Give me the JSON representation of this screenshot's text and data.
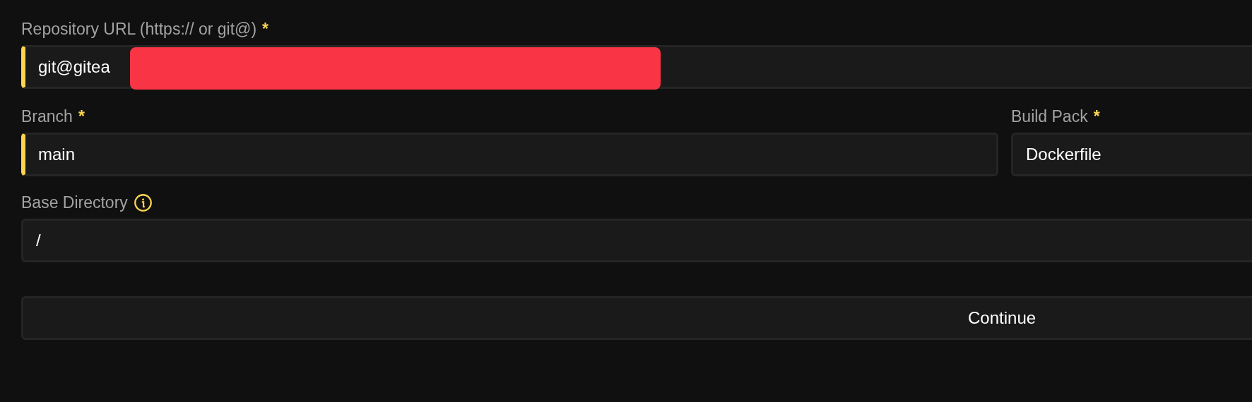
{
  "fields": [
    {
      "label": "Repository URL (https:// or git@)",
      "required": true,
      "required_mark": "*",
      "kind": "input",
      "value": "git@gitea",
      "redacted": true
    },
    {
      "label": "Branch",
      "required": true,
      "required_mark": "*",
      "kind": "input",
      "value": "main"
    },
    {
      "label": "Build Pack",
      "required": true,
      "required_mark": "*",
      "kind": "select",
      "value": "Dockerfile"
    },
    {
      "label": "Base Directory",
      "required": false,
      "info": true,
      "kind": "input",
      "value": "/"
    }
  ],
  "button": {
    "label": "Continue"
  }
}
